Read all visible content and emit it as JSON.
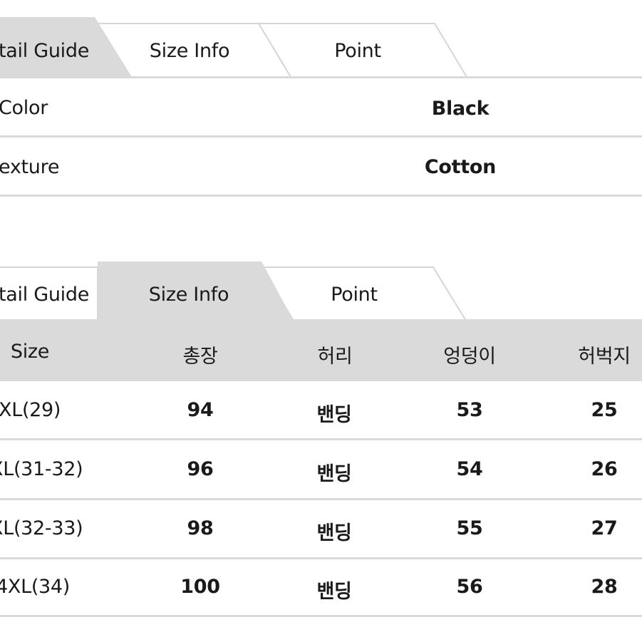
{
  "colors": {
    "active_tab": "#dadada",
    "inactive_tab": "#ffffff",
    "divider": "#dadada",
    "header_bg": "#dadada",
    "text": "#1a1a1a"
  },
  "detail_section": {
    "tabs": [
      {
        "label": "tail Guide",
        "active": true
      },
      {
        "label": "Size Info",
        "active": false
      },
      {
        "label": "Point",
        "active": false
      }
    ],
    "rows": [
      {
        "label": "Color",
        "value": "Black"
      },
      {
        "label": "exture",
        "value": "Cotton"
      }
    ]
  },
  "size_section": {
    "tabs": [
      {
        "label": "tail Guide",
        "active": false
      },
      {
        "label": "Size Info",
        "active": true
      },
      {
        "label": "Point",
        "active": false
      }
    ],
    "columns": [
      "Size",
      "총장",
      "허리",
      "엉덩이",
      "허벅지"
    ],
    "rows": [
      [
        "XL(29)",
        "94",
        "밴딩",
        "53",
        "25"
      ],
      [
        "XL(31-32)",
        "96",
        "밴딩",
        "54",
        "26"
      ],
      [
        "XL(32-33)",
        "98",
        "밴딩",
        "55",
        "27"
      ],
      [
        "4XL(34)",
        "100",
        "밴딩",
        "56",
        "28"
      ]
    ]
  }
}
